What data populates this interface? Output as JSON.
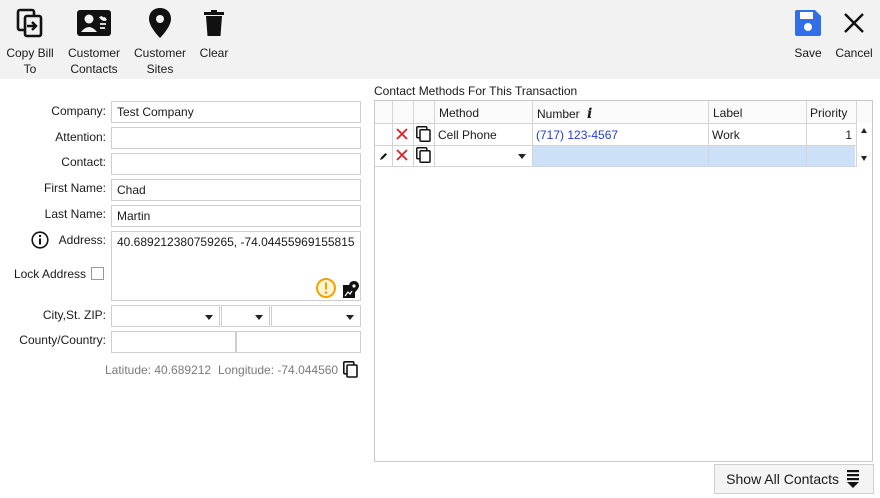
{
  "toolbar": {
    "copy_bill_to": "Copy Bill\nTo",
    "customer_contacts": "Customer\nContacts",
    "customer_sites": "Customer\nSites",
    "clear": "Clear",
    "save": "Save",
    "cancel": "Cancel"
  },
  "form": {
    "company_label": "Company:",
    "company_value": "Test Company",
    "attention_label": "Attention:",
    "attention_value": "",
    "contact_label": "Contact:",
    "contact_value": "",
    "first_name_label": "First Name:",
    "first_name_value": "Chad",
    "last_name_label": "Last Name:",
    "last_name_value": "Martin",
    "address_label": "Address:",
    "address_value": "40.689212380759265, -74.04455969155815",
    "lock_address_label": "Lock Address",
    "lock_address_checked": false,
    "city_st_zip_label": "City,St. ZIP:",
    "city_value": "",
    "state_value": "",
    "zip_value": "",
    "county_country_label": "County/Country:",
    "county_value": "",
    "country_value": "",
    "latitude_text": "Latitude: 40.689212",
    "longitude_text": "Longitude: -74.044560"
  },
  "grid": {
    "title": "Contact Methods For This Transaction",
    "columns": {
      "method": "Method",
      "number": "Number",
      "label": "Label",
      "priority": "Priority"
    },
    "rows": [
      {
        "method": "Cell Phone",
        "number": "(717) 123-4567",
        "label": "Work",
        "priority": "1"
      },
      {
        "method": "",
        "number": "",
        "label": "",
        "priority": ""
      }
    ]
  },
  "show_all_contacts": "Show All Contacts",
  "colors": {
    "toolbar_bg": "#f2f2f2",
    "save_icon": "#2f6fe8",
    "delete_icon": "#e02020",
    "warning_icon": "#f0a400",
    "phone_link": "#1f3fc8",
    "new_row_bg": "#cce0f7"
  }
}
